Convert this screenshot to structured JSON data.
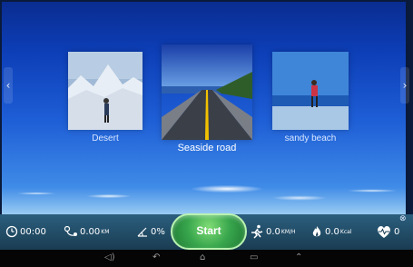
{
  "scenes": [
    {
      "name": "Desert"
    },
    {
      "name": "Seaside road"
    },
    {
      "name": "sandy beach"
    }
  ],
  "stats": {
    "time": "00:00",
    "distance": "0.00",
    "distance_unit": "KM",
    "incline": "0%",
    "speed": "0.0",
    "speed_unit": "KM/H",
    "calories": "0.0",
    "calories_unit": "Kcal",
    "heart_rate": "0"
  },
  "start_label": "Start",
  "icons": {
    "time": "clock-icon",
    "distance": "distance-icon",
    "incline": "incline-icon",
    "speed": "runner-icon",
    "calories": "flame-icon",
    "heart_rate": "heart-icon",
    "nav_volume": "volume-icon",
    "nav_back": "back-icon",
    "nav_home": "home-icon",
    "nav_recent": "recent-apps-icon",
    "nav_up": "up-icon"
  }
}
